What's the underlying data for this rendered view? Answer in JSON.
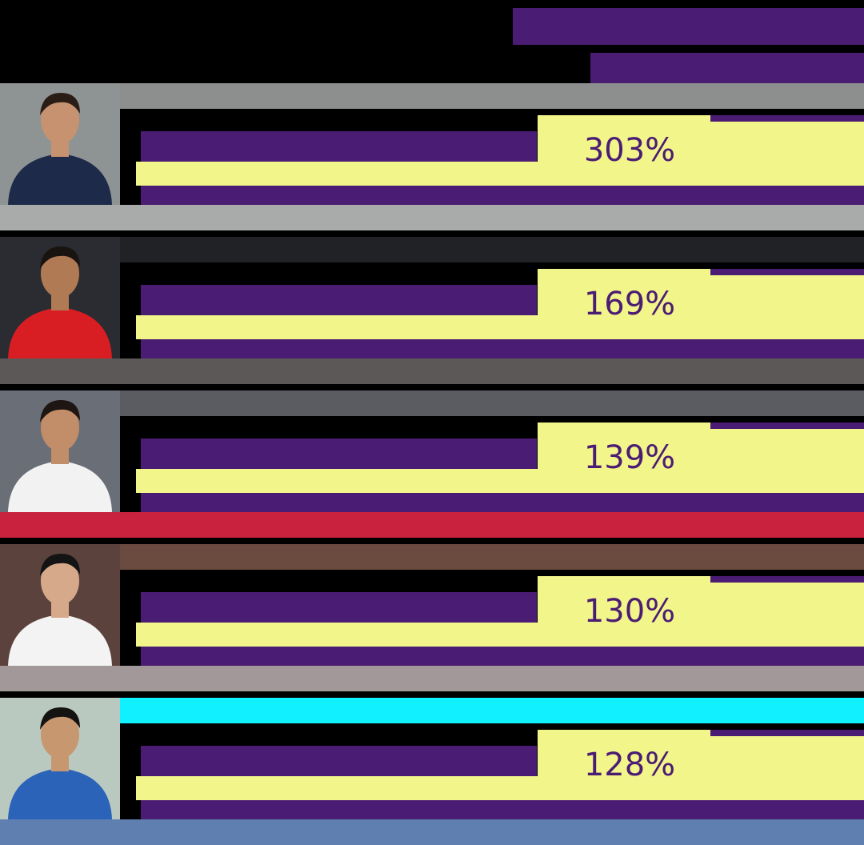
{
  "colors": {
    "purple": "#4B1C73",
    "yellow": "#F2F58A",
    "background": "#000000"
  },
  "chart_data": {
    "type": "bar",
    "categories": [
      "",
      "",
      "",
      "",
      ""
    ],
    "values": [
      303,
      169,
      139,
      130,
      128
    ],
    "value_labels": [
      "303%",
      "169%",
      "139%",
      "130%",
      "128%"
    ],
    "unit": "%"
  }
}
